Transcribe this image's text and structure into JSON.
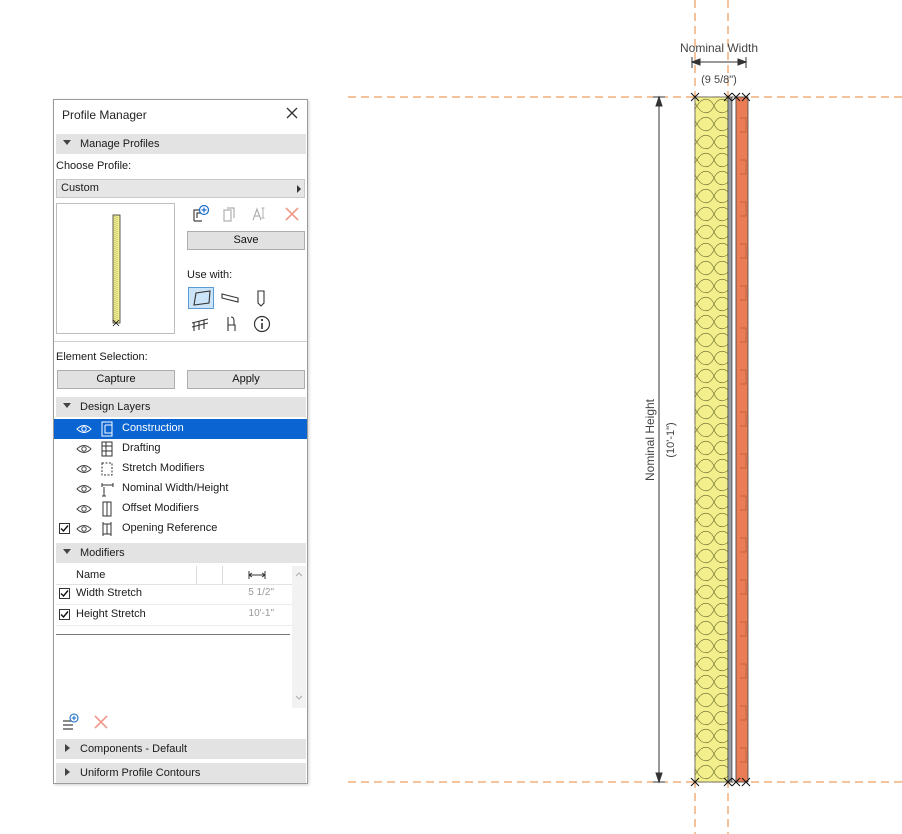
{
  "panel": {
    "title": "Profile Manager",
    "close_icon": "close-icon"
  },
  "manage_profiles": {
    "header": "Manage Profiles",
    "choose_label": "Choose Profile:",
    "selected_profile": "Custom",
    "save_label": "Save",
    "use_with_label": "Use with:",
    "icons": [
      "new-profile-icon",
      "duplicate-profile-icon",
      "rename-profile-icon",
      "delete-profile-icon"
    ],
    "use_with_icons": [
      "wall-icon",
      "beam-icon",
      "column-icon",
      "railing-icon",
      "object-icon",
      "info-icon"
    ]
  },
  "element_selection": {
    "label": "Element Selection:",
    "capture_label": "Capture",
    "apply_label": "Apply"
  },
  "design_layers": {
    "header": "Design Layers",
    "items": [
      {
        "label": "Construction",
        "selected": true,
        "checked": false
      },
      {
        "label": "Drafting",
        "selected": false,
        "checked": false
      },
      {
        "label": "Stretch Modifiers",
        "selected": false,
        "checked": false
      },
      {
        "label": "Nominal Width/Height",
        "selected": false,
        "checked": false
      },
      {
        "label": "Offset Modifiers",
        "selected": false,
        "checked": false
      },
      {
        "label": "Opening Reference",
        "selected": false,
        "checked": true
      }
    ]
  },
  "modifiers": {
    "header": "Modifiers",
    "col_name": "Name",
    "rows": [
      {
        "name": "Width Stretch",
        "value": "5 1/2\"",
        "checked": true
      },
      {
        "name": "Height Stretch",
        "value": "10'-1\"",
        "checked": true
      }
    ]
  },
  "components": {
    "header": "Components - Default"
  },
  "contours": {
    "header": "Uniform Profile Contours"
  },
  "drawing": {
    "nominal_width_label": "Nominal Width",
    "nominal_width_value": "(9 5/8\")",
    "nominal_height_label": "Nominal Height",
    "nominal_height_value": "(10'-1\")",
    "colors": {
      "guide": "#e8873a",
      "insulation": "#f3ef8c",
      "brick": "#ea7d55",
      "dim": "#333333"
    }
  }
}
